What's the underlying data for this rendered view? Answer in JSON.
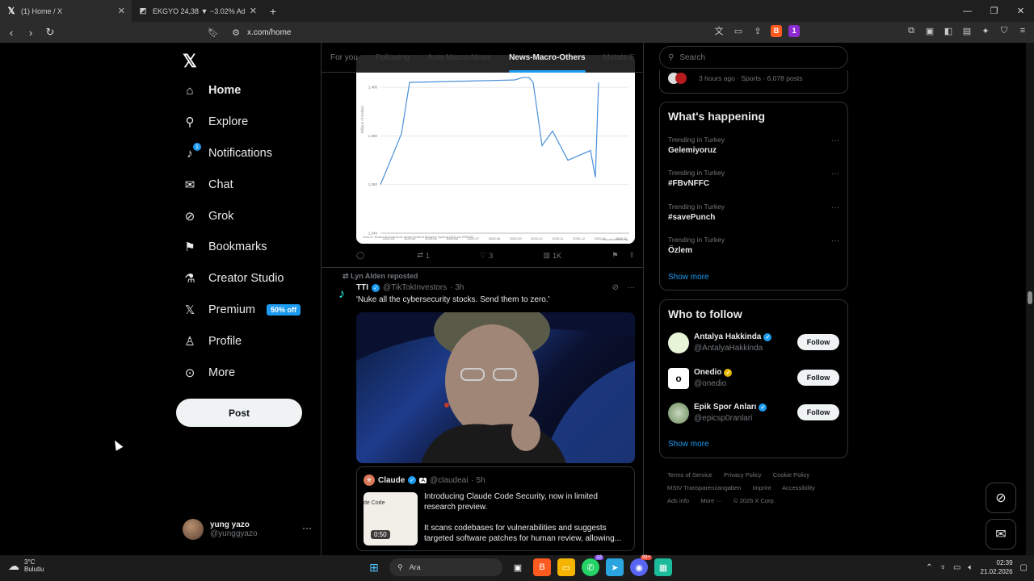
{
  "browser": {
    "tabs": [
      {
        "title": "(1) Home / X",
        "favicon": "x-logo-icon",
        "active": true
      },
      {
        "title": "EKGYO 24,38 ▼ −3.02% Adsız",
        "favicon": "chart-icon",
        "active": false
      }
    ],
    "url": "x.com/home",
    "brave_badge": "1"
  },
  "sidebar": {
    "items": [
      {
        "label": "Home",
        "icon": "home-icon"
      },
      {
        "label": "Explore",
        "icon": "search-icon"
      },
      {
        "label": "Notifications",
        "icon": "bell-icon",
        "badge": "1"
      },
      {
        "label": "Chat",
        "icon": "mail-icon"
      },
      {
        "label": "Grok",
        "icon": "grok-icon"
      },
      {
        "label": "Bookmarks",
        "icon": "bookmark-icon"
      },
      {
        "label": "Creator Studio",
        "icon": "flask-icon"
      },
      {
        "label": "Premium",
        "icon": "x-logo-icon",
        "badge": "50% off"
      },
      {
        "label": "Profile",
        "icon": "person-icon"
      },
      {
        "label": "More",
        "icon": "more-circle-icon"
      }
    ],
    "post_label": "Post",
    "account": {
      "name": "yung yazo",
      "handle": "@yunggyazo"
    }
  },
  "feed": {
    "tabs": [
      "For you",
      "Following",
      "Asia-Macro-News",
      "News-Macro-Others",
      "Metals-E"
    ],
    "active_tab": "News-Macro-Others",
    "post1": {
      "chart_source": "Source: Board of Governors of the Federal Reserve System (US) via FRED®",
      "chart_brand": "fred.stlouisfed.org",
      "y_axis_label": "Billions of Dollars",
      "replies": "",
      "reposts": "1",
      "likes": "3",
      "views": "1K"
    },
    "post2": {
      "repost_by": "Lyn Alden reposted",
      "name": "TTI",
      "handle": "@TikTokInvestors",
      "time": "· 3h",
      "text": "'Nuke all the cybersecurity stocks. Send them to zero.'",
      "quote": {
        "name": "Claude",
        "handle": "@claudeai",
        "time": "· 5h",
        "video_duration": "0:50",
        "thumb_text": "de Code",
        "text1": "Introducing Claude Code Security, now in limited research preview.",
        "text2": "It scans codebases for vulnerabilities and suggests targeted software patches for human review, allowing..."
      }
    }
  },
  "chart_data": {
    "type": "line",
    "x": [
      "2025-03",
      "2025-04",
      "2025-05",
      "2025-06",
      "2025-07",
      "2025-08",
      "2025-09",
      "2025-10",
      "2025-11",
      "2025-12",
      "2026-01",
      "2026-02"
    ],
    "ylabel": "Billions of Dollars",
    "ytick_labels": [
      "1,340",
      "1,360",
      "1,380",
      "1,400"
    ],
    "series": [
      {
        "values": [
          1360,
          1372,
          1381,
          1402,
          1403,
          1404,
          1404,
          1402,
          1376,
          1382,
          1370,
          1374,
          1363,
          1402
        ]
      }
    ]
  },
  "right": {
    "search_placeholder": "Search",
    "top_snippet": "3 hours ago · Sports · 6,078 posts",
    "happening_title": "What's happening",
    "trends": [
      {
        "meta": "Trending in Turkey",
        "name": "Gelemiyoruz"
      },
      {
        "meta": "Trending in Turkey",
        "name": "#FBvNFFC"
      },
      {
        "meta": "Trending in Turkey",
        "name": "#savePunch"
      },
      {
        "meta": "Trending in Turkey",
        "name": "Özlem"
      }
    ],
    "show_more": "Show more",
    "wtf_title": "Who to follow",
    "wtf": [
      {
        "name": "Antalya Hakkinda",
        "handle": "@AntalyaHakkinda",
        "badge": "blue",
        "avatar_color": "#e8f4d8"
      },
      {
        "name": "Onedio",
        "handle": "@onedio",
        "badge": "gold",
        "avatar_color": "#ffffff"
      },
      {
        "name": "Epik Spor Anları",
        "handle": "@epicsp0ranlari",
        "badge": "blue",
        "avatar_color": "#c8d8c0"
      }
    ],
    "follow_label": "Follow",
    "footer": [
      "Terms of Service",
      "Privacy Policy",
      "Cookie Policy",
      "MStV Transparenzangaben",
      "Imprint",
      "Accessibility",
      "Ads info",
      "More ···",
      "© 2026 X Corp."
    ]
  },
  "taskbar": {
    "weather_temp": "3°C",
    "weather_desc": "Bulutlu",
    "search_label": "Ara",
    "time": "02:39",
    "date": "21.02.2026",
    "whatsapp_badge": "12",
    "discord_badge": "99+"
  }
}
